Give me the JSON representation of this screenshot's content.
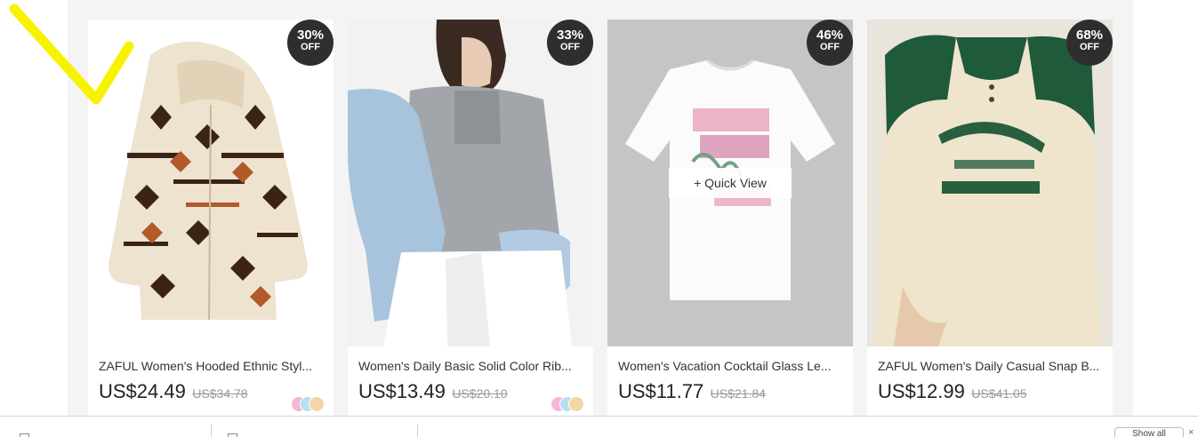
{
  "products": [
    {
      "title": "ZAFUL Women's Hooded Ethnic Styl...",
      "price": "US$24.49",
      "original_price": "US$34.78",
      "discount_pct": "30%",
      "discount_label": "OFF",
      "swatch_colors": [
        "#f6b7d6",
        "#b6dff2",
        "#f4d6a6"
      ]
    },
    {
      "title": "Women's Daily Basic Solid Color Rib...",
      "price": "US$13.49",
      "original_price": "US$20.10",
      "discount_pct": "33%",
      "discount_label": "OFF",
      "swatch_colors": [
        "#f6b7d6",
        "#b6dff2",
        "#f4d6a6"
      ]
    },
    {
      "title": "Women's Vacation Cocktail Glass Le...",
      "price": "US$11.77",
      "original_price": "US$21.84",
      "discount_pct": "46%",
      "discount_label": "OFF",
      "quick_view": "+ Quick View"
    },
    {
      "title": "ZAFUL Women's Daily Casual Snap B...",
      "price": "US$12.99",
      "original_price": "US$41.05",
      "discount_pct": "68%",
      "discount_label": "OFF"
    }
  ],
  "bottom_bar": {
    "show_all_label": "Show all",
    "close_label": "×"
  },
  "colors": {
    "page_bg": "#f4f4f4",
    "badge_bg": "#2e2e2e",
    "annotation_check": "#f7f200"
  }
}
